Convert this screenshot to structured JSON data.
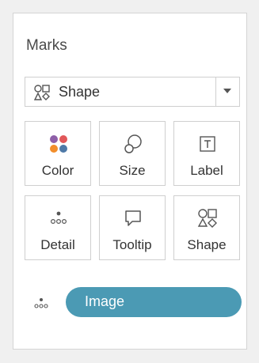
{
  "panel": {
    "title": "Marks"
  },
  "mark_type": {
    "selected": "Shape",
    "icon": "shapes-icon"
  },
  "cards": [
    {
      "label": "Color",
      "icon": "color-dots-icon"
    },
    {
      "label": "Size",
      "icon": "size-icon"
    },
    {
      "label": "Label",
      "icon": "text-label-icon"
    },
    {
      "label": "Detail",
      "icon": "detail-dots-icon"
    },
    {
      "label": "Tooltip",
      "icon": "tooltip-icon"
    },
    {
      "label": "Shape",
      "icon": "shapes-icon"
    }
  ],
  "field": {
    "label": "Image",
    "icon": "detail-dots-icon"
  },
  "colors": {
    "pill": "#4b9ab4",
    "dot_purple": "#8e5fa8",
    "dot_red": "#e15759",
    "dot_orange": "#f28e2b",
    "dot_blue": "#4e79a7"
  }
}
